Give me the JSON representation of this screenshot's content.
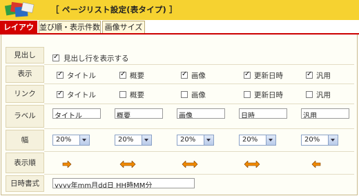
{
  "header": {
    "title": "［ ページリスト設定(表タイプ) ］"
  },
  "tabs": [
    {
      "label": "レイアウト",
      "active": true
    },
    {
      "label": "並び順・表示件数",
      "active": false
    },
    {
      "label": "画像サイズ",
      "active": false
    }
  ],
  "rows": {
    "heading_label": "見出し",
    "heading_checkbox": {
      "label": "見出し行を表示する",
      "checked": true
    },
    "display_label": "表示",
    "link_label": "リンク",
    "label_label": "ラベル",
    "width_label": "幅",
    "order_label": "表示順",
    "date_format_label": "日時書式",
    "date_format_value": "yyyy年mm月dd日 HH時MM分"
  },
  "columns": [
    {
      "name": "タイトル",
      "display": true,
      "link": true,
      "label": "タイトル",
      "width": "20%",
      "order": "right"
    },
    {
      "name": "概要",
      "display": true,
      "link": false,
      "label": "概要",
      "width": "20%",
      "order": "both"
    },
    {
      "name": "画像",
      "display": true,
      "link": false,
      "label": "画像",
      "width": "20%",
      "order": "both"
    },
    {
      "name": "更新日時",
      "display": true,
      "link": false,
      "label": "日時",
      "width": "20%",
      "order": "both"
    },
    {
      "name": "汎用",
      "display": true,
      "link": false,
      "label": "汎用",
      "width": "20%",
      "order": "left"
    }
  ],
  "colors": {
    "header_bg": "#f6d230",
    "tab_active": "#d40000",
    "arrow": "#f08a00"
  }
}
